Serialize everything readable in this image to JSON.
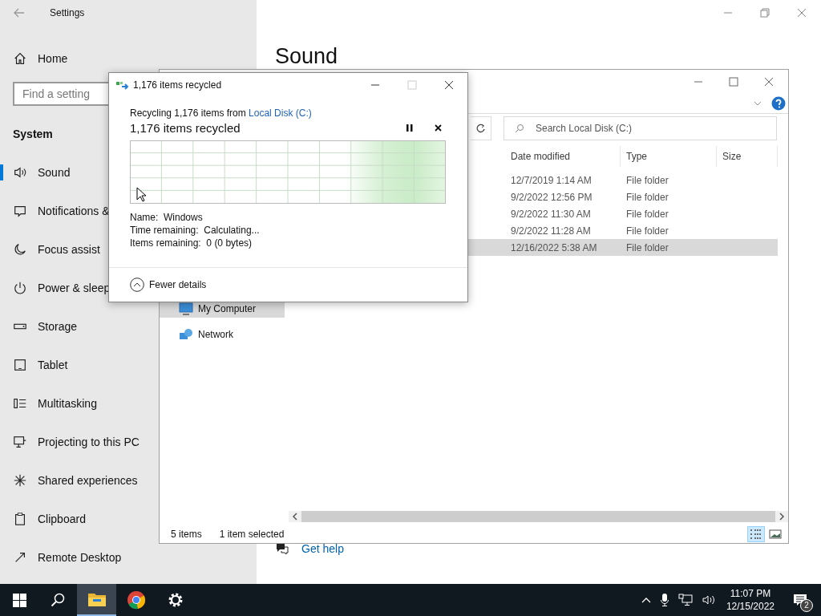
{
  "settings_window": {
    "title": "Settings",
    "home": "Home",
    "search": {
      "placeholder": "Find a setting"
    },
    "section": "System",
    "items": [
      {
        "label": "Sound",
        "kind": "sound",
        "selected": true
      },
      {
        "label": "Notifications &",
        "kind": "notifications",
        "selected": false
      },
      {
        "label": "Focus assist",
        "kind": "focus",
        "selected": false
      },
      {
        "label": "Power & sleep",
        "kind": "power",
        "selected": false
      },
      {
        "label": "Storage",
        "kind": "storage",
        "selected": false
      },
      {
        "label": "Tablet",
        "kind": "tablet",
        "selected": false
      },
      {
        "label": "Multitasking",
        "kind": "multitasking",
        "selected": false
      },
      {
        "label": "Projecting to this PC",
        "kind": "projecting",
        "selected": false
      },
      {
        "label": "Shared experiences",
        "kind": "shared",
        "selected": false
      },
      {
        "label": "Clipboard",
        "kind": "clipboard",
        "selected": false
      },
      {
        "label": "Remote Desktop",
        "kind": "remote",
        "selected": false
      }
    ],
    "page_title": "Sound",
    "help_link": "Get help"
  },
  "explorer": {
    "search": {
      "placeholder": "Search Local Disk (C:)"
    },
    "columns": [
      "Date modified",
      "Type",
      "Size"
    ],
    "rows": [
      {
        "date": "12/7/2019 1:14 AM",
        "type": "File folder",
        "selected": false
      },
      {
        "date": "9/2/2022 12:56 PM",
        "type": "File folder",
        "selected": false
      },
      {
        "date": "9/2/2022 11:30 AM",
        "type": "File folder",
        "selected": false
      },
      {
        "date": "9/2/2022 11:28 AM",
        "type": "File folder",
        "selected": false
      },
      {
        "date": "12/16/2022 5:38 AM",
        "type": "File folder",
        "selected": true
      }
    ],
    "nav_items": [
      {
        "label": "My Computer",
        "kind": "computer",
        "selected": true
      },
      {
        "label": "Network",
        "kind": "network",
        "selected": false
      }
    ],
    "status": {
      "count": "5 items",
      "selection": "1 item selected"
    },
    "views": [
      {
        "kind": "details",
        "selected": true
      },
      {
        "kind": "preview",
        "selected": false
      }
    ]
  },
  "dialog": {
    "title": "1,176 items recycled",
    "source_prefix": "Recycling 1,176 items from ",
    "source_link": "Local Disk (C:)",
    "heading": "1,176 items recycled",
    "details": [
      "Name:  Windows",
      "Time remaining:  Calculating...",
      "Items remaining:  0 (0 bytes)"
    ],
    "toggle": "Fewer details"
  },
  "taskbar": {
    "apps": [
      {
        "kind": "explorer",
        "active": true
      },
      {
        "kind": "browser",
        "active": false
      },
      {
        "kind": "settings",
        "active": false
      }
    ],
    "time": "11:07 PM",
    "date": "12/15/2022",
    "notifications": "2"
  }
}
